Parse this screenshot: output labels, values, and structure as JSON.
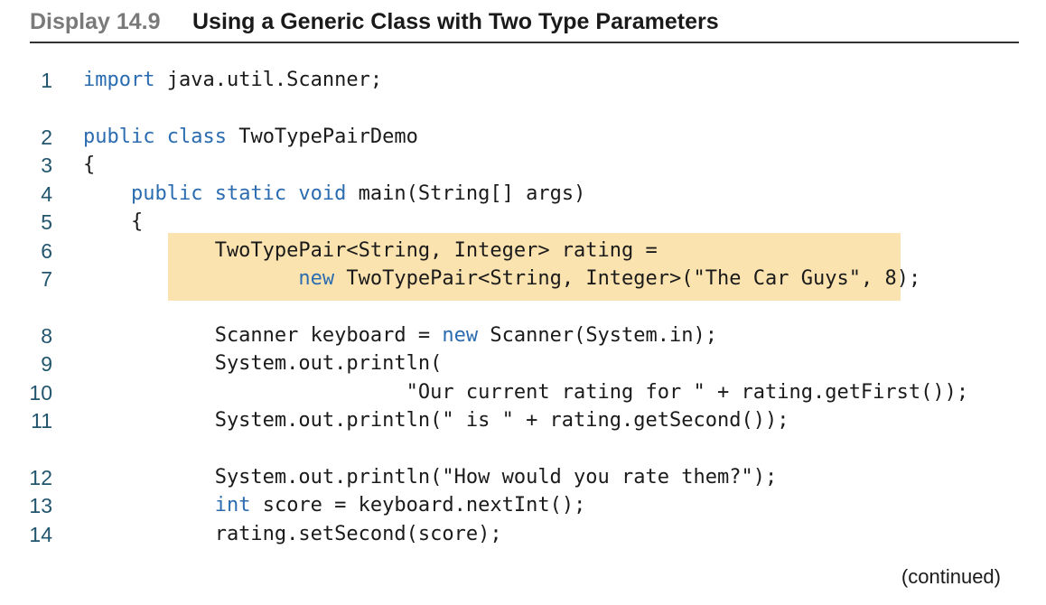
{
  "header": {
    "label": "Display 14.9",
    "title": "Using a Generic Class with Two Type Parameters"
  },
  "lines": [
    {
      "num": "1",
      "parts": [
        {
          "t": "import",
          "kw": true
        },
        {
          "t": " java.util.Scanner;"
        }
      ]
    },
    {
      "num": "2",
      "parts": [
        {
          "t": "public class",
          "kw": true
        },
        {
          "t": " TwoTypePairDemo"
        }
      ]
    },
    {
      "num": "3",
      "parts": [
        {
          "t": "{"
        }
      ]
    },
    {
      "num": "4",
      "parts": [
        {
          "t": "    "
        },
        {
          "t": "public static void",
          "kw": true
        },
        {
          "t": " main(String[] args)"
        }
      ]
    },
    {
      "num": "5",
      "parts": [
        {
          "t": "    {"
        }
      ]
    },
    {
      "num": "6",
      "parts": [
        {
          "t": "           TwoTypePair<String, Integer> rating ="
        }
      ]
    },
    {
      "num": "7",
      "parts": [
        {
          "t": "                  "
        },
        {
          "t": "new",
          "kw": true
        },
        {
          "t": " TwoTypePair<String, Integer>(\"The Car Guys\", 8);"
        }
      ]
    },
    {
      "num": "8",
      "parts": [
        {
          "t": "           Scanner keyboard = "
        },
        {
          "t": "new",
          "kw": true
        },
        {
          "t": " Scanner(System.in);"
        }
      ]
    },
    {
      "num": "9",
      "parts": [
        {
          "t": "           System.out.println("
        }
      ]
    },
    {
      "num": "10",
      "parts": [
        {
          "t": "                           \"Our current rating for \" + rating.getFirst());"
        }
      ]
    },
    {
      "num": "11",
      "parts": [
        {
          "t": "           System.out.println(\" is \" + rating.getSecond());"
        }
      ]
    },
    {
      "num": "12",
      "parts": [
        {
          "t": "           System.out.println(\"How would you rate them?\");"
        }
      ]
    },
    {
      "num": "13",
      "parts": [
        {
          "t": "           "
        },
        {
          "t": "int",
          "kw": true
        },
        {
          "t": " score = keyboard.nextInt();"
        }
      ]
    },
    {
      "num": "14",
      "parts": [
        {
          "t": "           rating.setSecond(score);"
        }
      ]
    }
  ],
  "footer": {
    "continued": "(continued)"
  },
  "colors": {
    "keyword": "#2b6cb0",
    "highlight": "#fbe3b0",
    "line_number": "#22556e"
  }
}
